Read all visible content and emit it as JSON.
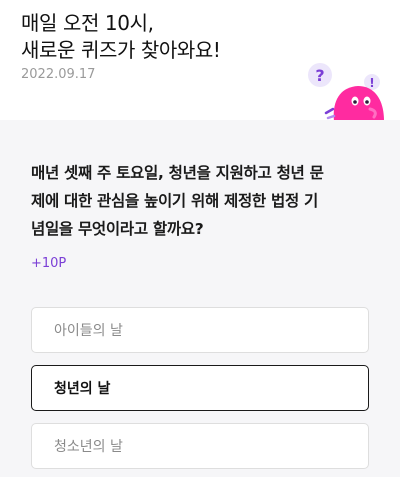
{
  "header": {
    "headline_line1": "매일 오전 10시,",
    "headline_line2": "새로운 퀴즈가 찾아와요!",
    "date": "2022.09.17",
    "mascot_marks": [
      "?",
      "!"
    ]
  },
  "quiz": {
    "question_line1": "매년 셋째 주 토요일, 청년을 지원하고 청년 문",
    "question_line2": "제에 대한 관심을 높이기 위해 제정한 법정 기",
    "question_line3": "념일을 무엇이라고 할까요?",
    "points": "+10P",
    "options": [
      {
        "label": "아이들의 날",
        "selected": false
      },
      {
        "label": "청년의 날",
        "selected": true
      },
      {
        "label": "청소년의 날",
        "selected": false
      }
    ]
  },
  "colors": {
    "accent_purple": "#7b3fd6",
    "mascot_pink": "#ff2ba0",
    "content_bg": "#f6f6f8"
  }
}
